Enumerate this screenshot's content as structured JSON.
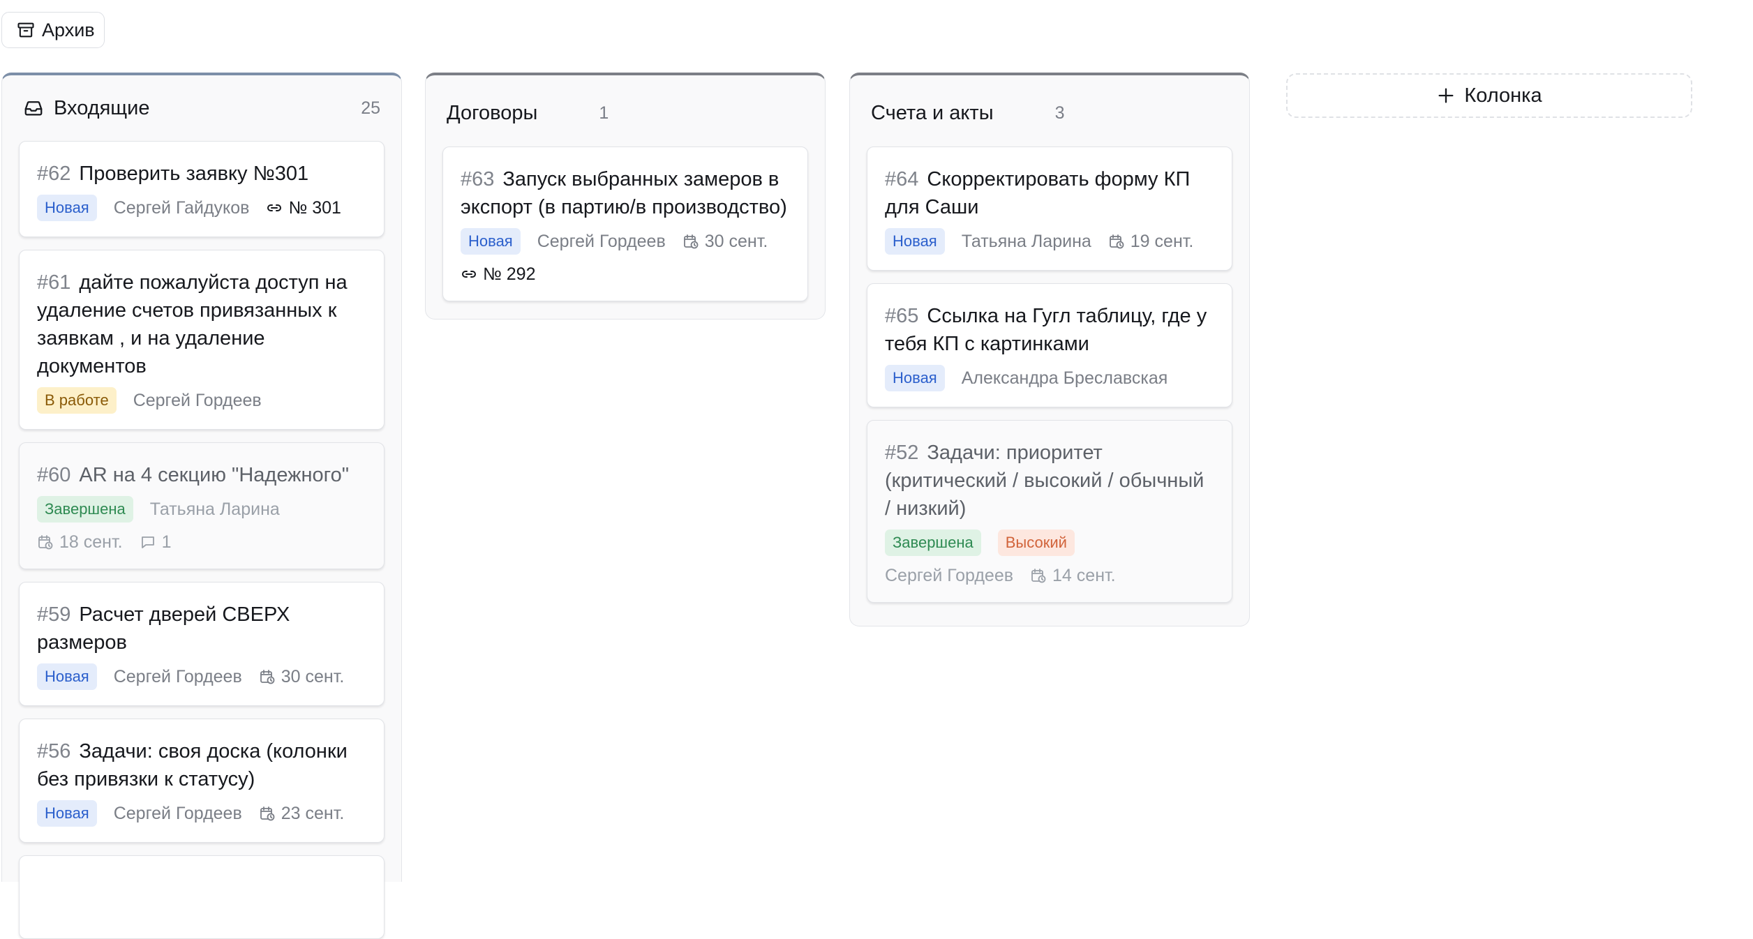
{
  "toolbar": {
    "archive_label": "Архив"
  },
  "add_column_label": "Колонка",
  "colors": {
    "badge_new": "#2b5fcc",
    "badge_in_work": "#8a5a07",
    "badge_done": "#2e8a52",
    "badge_high": "#d1633a"
  },
  "columns": [
    {
      "title": "Входящие",
      "count": "25",
      "icon": "inbox-icon",
      "cards": [
        {
          "num": "#62",
          "title": "Проверить заявку №301",
          "status": "Новая",
          "assignee": "Сергей Гайдуков",
          "link": "№ 301"
        },
        {
          "num": "#61",
          "title": "дайте пожалуйста доступ на удаление счетов привязанных к заявкам , и на удаление документов",
          "status": "В работе",
          "assignee": "Сергей Гордеев"
        },
        {
          "num": "#60",
          "title": "AR на 4 секцию \"Надежного\"",
          "status": "Завершена",
          "assignee": "Татьяна Ларина",
          "date": "18 сент.",
          "comments": "1"
        },
        {
          "num": "#59",
          "title": "Расчет дверей СВЕРХ размеров",
          "status": "Новая",
          "assignee": "Сергей Гордеев",
          "date": "30 сент."
        },
        {
          "num": "#56",
          "title": "Задачи: своя доска (колонки без привязки к статусу)",
          "status": "Новая",
          "assignee": "Сергей Гордеев",
          "date": "23 сент."
        }
      ]
    },
    {
      "title": "Договоры",
      "count": "1",
      "cards": [
        {
          "num": "#63",
          "title": "Запуск выбранных замеров в экспорт (в партию/в производство)",
          "status": "Новая",
          "assignee": "Сергей Гордеев",
          "date": "30 сент.",
          "link": "№ 292"
        }
      ]
    },
    {
      "title": "Счета и акты",
      "count": "3",
      "cards": [
        {
          "num": "#64",
          "title": "Скорректировать форму КП для Саши",
          "status": "Новая",
          "assignee": "Татьяна Ларина",
          "date": "19 сент."
        },
        {
          "num": "#65",
          "title": "Ссылка на Гугл таблицу, где у тебя КП с картинками",
          "status": "Новая",
          "assignee": "Александра Бреславская"
        },
        {
          "num": "#52",
          "title": "Задачи: приоритет (критический / высокий / обычный / низкий)",
          "status": "Завершена",
          "priority": "Высокий",
          "assignee": "Сергей Гордеев",
          "date": "14 сент."
        }
      ]
    }
  ]
}
